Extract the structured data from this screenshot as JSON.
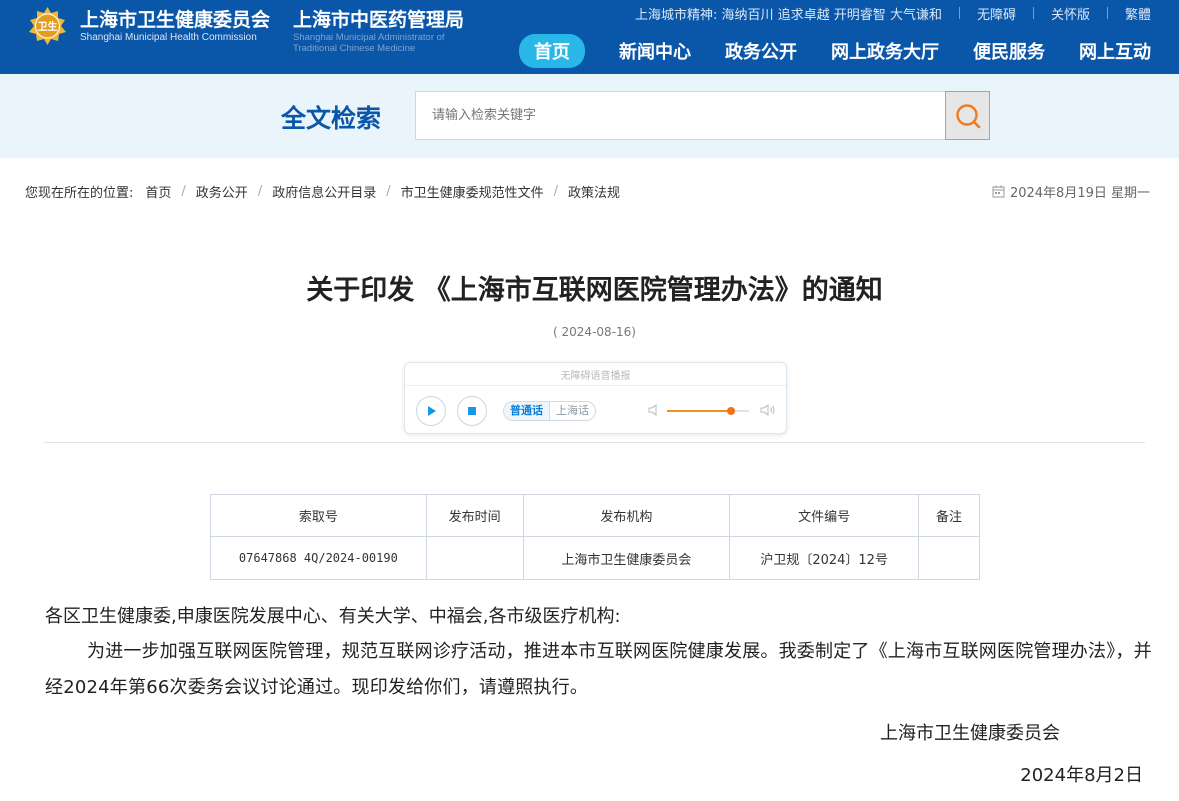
{
  "header": {
    "org1_cn": "上海市卫生健康委员会",
    "org1_en": "Shanghai Municipal Health Commission",
    "org2_cn": "上海市中医药管理局",
    "org2_en_line1": "Shanghai Municipal Administrator of",
    "org2_en_line2": "Traditional Chinese Medicine",
    "city_spirit": "上海城市精神: 海纳百川 追求卓越 开明睿智 大气谦和",
    "accessibility": "无障碍",
    "care_version": "关怀版",
    "traditional": "繁體",
    "nav": [
      "首页",
      "新闻中心",
      "政务公开",
      "网上政务大厅",
      "便民服务",
      "网上互动"
    ],
    "logo_text": "卫生"
  },
  "search": {
    "title": "全文检索",
    "placeholder": "请输入检索关键字",
    "button_icon": "search-icon"
  },
  "breadcrumb": {
    "label": "您现在所在的位置:",
    "items": [
      "首页",
      "政务公开",
      "政府信息公开目录",
      "市卫生健康委规范性文件",
      "政策法规"
    ],
    "today": "2024年8月19日 星期一"
  },
  "article": {
    "title": "关于印发 《上海市互联网医院管理办法》的通知",
    "date": "( 2024-08-16)",
    "player": {
      "title": "无障碍语音播报",
      "lang_mandarin": "普通话",
      "lang_shanghai": "上海话",
      "volume": 0.78
    },
    "meta_headers": [
      "索取号",
      "发布时间",
      "发布机构",
      "文件编号",
      "备注"
    ],
    "meta_values": [
      "07647868 4Q/2024-00190",
      "",
      "上海市卫生健康委员会",
      "沪卫规〔2024〕12号",
      ""
    ],
    "addressee": "各区卫生健康委,申康医院发展中心、有关大学、中福会,各市级医疗机构:",
    "paragraph": "为进一步加强互联网医院管理，规范互联网诊疗活动，推进本市互联网医院健康发展。我委制定了《上海市互联网医院管理办法》，并经2024年第66次委务会议讨论通过。现印发给你们，请遵照执行。",
    "signature": "上海市卫生健康委员会",
    "sign_date": "2024年8月2日"
  },
  "colors": {
    "brand_blue": "#0a56a8",
    "nav_active": "#29b7e8",
    "search_band": "#eaf4fb",
    "volume_orange": "#f18f22"
  }
}
